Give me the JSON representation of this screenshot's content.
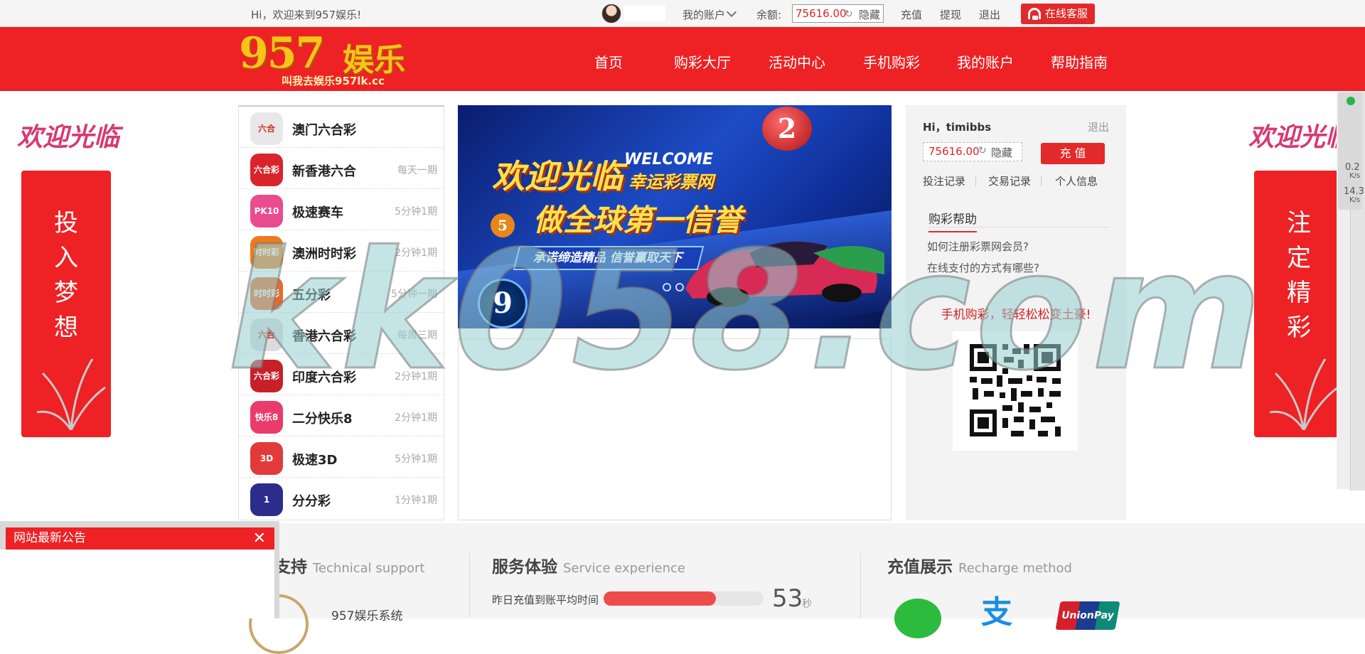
{
  "topbar": {
    "welcome": "Hi，欢迎来到957娱乐!",
    "my_account": "我的账户",
    "balance_label": "余额:",
    "balance": "75616.00",
    "hide": "隐藏",
    "recharge": "充值",
    "withdraw": "提现",
    "logout": "退出",
    "service": "在线客服"
  },
  "logo": {
    "main": "957",
    "cn": "娱乐",
    "sub": "叫我去娱乐957lk.cc"
  },
  "nav": [
    "首页",
    "购彩大厅",
    "活动中心",
    "手机购彩",
    "我的账户",
    "帮助指南"
  ],
  "side_left": {
    "welcome": "欢迎光临",
    "text": [
      "投",
      "入",
      "梦",
      "想"
    ]
  },
  "side_right": {
    "welcome": "欢迎光临",
    "text": [
      "注",
      "定",
      "精",
      "彩"
    ]
  },
  "lotteries": [
    {
      "name": "澳门六合彩",
      "freq": "",
      "icon": "六合",
      "color": "#e8e8e8"
    },
    {
      "name": "新香港六合",
      "freq": "每天一期",
      "icon": "六合彩",
      "color": "#d9242c"
    },
    {
      "name": "极速赛车",
      "freq": "5分钟1期",
      "icon": "PK10",
      "color": "#e94c8f"
    },
    {
      "name": "澳洲时时彩",
      "freq": "2分钟1期",
      "icon": "时时彩",
      "color": "#ef7a1d"
    },
    {
      "name": "五分彩",
      "freq": "5分钟一期",
      "icon": "时时彩",
      "color": "#e86a2a"
    },
    {
      "name": "香港六合彩",
      "freq": "每周三期",
      "icon": "六合",
      "color": "#dcdcdc"
    },
    {
      "name": "印度六合彩",
      "freq": "2分钟1期",
      "icon": "六合彩",
      "color": "#c72028"
    },
    {
      "name": "二分快乐8",
      "freq": "2分钟1期",
      "icon": "快乐8",
      "color": "#ea3b6a"
    },
    {
      "name": "极速3D",
      "freq": "5分钟1期",
      "icon": "3D",
      "color": "#e23a3a"
    },
    {
      "name": "分分彩",
      "freq": "1分钟1期",
      "icon": "1",
      "color": "#2b2c8c"
    }
  ],
  "banner": {
    "title": "欢迎光临",
    "welcome": "WELCOME",
    "site": "幸运彩票网",
    "slogan": "做全球第一信誉",
    "ribbon": "承诺缔造精品 信誉赢取天下",
    "ball1": "2",
    "ball2": "5",
    "ball3": "9"
  },
  "user": {
    "hi": "Hi，timibbs",
    "logout": "退出",
    "balance": "75616.00",
    "hide": "隐藏",
    "recharge": "充 值",
    "links": [
      "投注记录",
      "交易记录",
      "个人信息"
    ],
    "help_title": "购彩帮助",
    "questions": [
      "如何注册彩票网会员?",
      "在线支付的方式有哪些?"
    ],
    "mobile": "手机购彩，轻轻松松变土豪!"
  },
  "bottom": {
    "support": "支持",
    "support_en": "Technical support",
    "service": "服务体验",
    "service_en": "Service experience",
    "recharge": "充值展示",
    "recharge_en": "Recharge method",
    "yesterday": "昨日充值到账平均时间",
    "seconds": "53",
    "sec_unit": "秒",
    "system": "957娱乐系统",
    "progress": 0.7
  },
  "notice": {
    "title": "网站最新公告",
    "close": "✕"
  },
  "watermark": "kk058.com",
  "speed": {
    "up": "0.2",
    "down": "14.3",
    "unit": "K/s"
  }
}
